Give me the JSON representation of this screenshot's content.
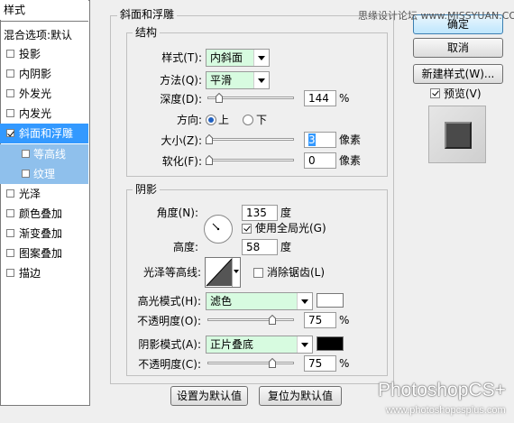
{
  "sidebar": {
    "header": "样式",
    "blend": "混合选项:默认",
    "items": [
      {
        "label": "投影",
        "checked": false
      },
      {
        "label": "内阴影",
        "checked": false
      },
      {
        "label": "外发光",
        "checked": false
      },
      {
        "label": "内发光",
        "checked": false
      },
      {
        "label": "斜面和浮雕",
        "checked": true
      },
      {
        "label": "等高线",
        "checked": false
      },
      {
        "label": "纹理",
        "checked": false
      },
      {
        "label": "光泽",
        "checked": false
      },
      {
        "label": "颜色叠加",
        "checked": false
      },
      {
        "label": "渐变叠加",
        "checked": false
      },
      {
        "label": "图案叠加",
        "checked": false
      },
      {
        "label": "描边",
        "checked": false
      }
    ]
  },
  "bevel": {
    "title": "斜面和浮雕",
    "structure": {
      "title": "结构",
      "style_label": "样式(T):",
      "style_value": "内斜面",
      "technique_label": "方法(Q):",
      "technique_value": "平滑",
      "depth_label": "深度(D):",
      "depth_value": "144",
      "depth_unit": "%",
      "direction_label": "方向:",
      "direction_up": "上",
      "direction_down": "下",
      "direction_selected": "上",
      "size_label": "大小(Z):",
      "size_value": "3",
      "size_unit": "像素",
      "soften_label": "软化(F):",
      "soften_value": "0",
      "soften_unit": "像素"
    },
    "shading": {
      "title": "阴影",
      "angle_label": "角度(N):",
      "angle_value": "135",
      "angle_unit": "度",
      "global_light_label": "使用全局光(G)",
      "global_light_checked": true,
      "altitude_label": "高度:",
      "altitude_value": "58",
      "altitude_unit": "度",
      "gloss_label": "光泽等高线:",
      "antialias_label": "消除锯齿(L)",
      "antialias_checked": false,
      "highlight_label": "高光模式(H):",
      "highlight_mode": "滤色",
      "highlight_color": "#ffffff",
      "highlight_opacity_label": "不透明度(O):",
      "highlight_opacity": "75",
      "shadow_label": "阴影模式(A):",
      "shadow_mode": "正片叠底",
      "shadow_color": "#000000",
      "shadow_opacity_label": "不透明度(C):",
      "shadow_opacity": "75",
      "percent": "%"
    },
    "make_default": "设置为默认值",
    "reset_default": "复位为默认值"
  },
  "actions": {
    "ok": "确定",
    "cancel": "取消",
    "new_style": "新建样式(W)...",
    "preview_label": "预览(V)",
    "preview_checked": true
  },
  "watermarks": {
    "top": "思缘设计论坛 www.MISSYUAN.COM",
    "brand": "PhotoshopCS+",
    "url": "www.photoshopcsplus.com"
  }
}
